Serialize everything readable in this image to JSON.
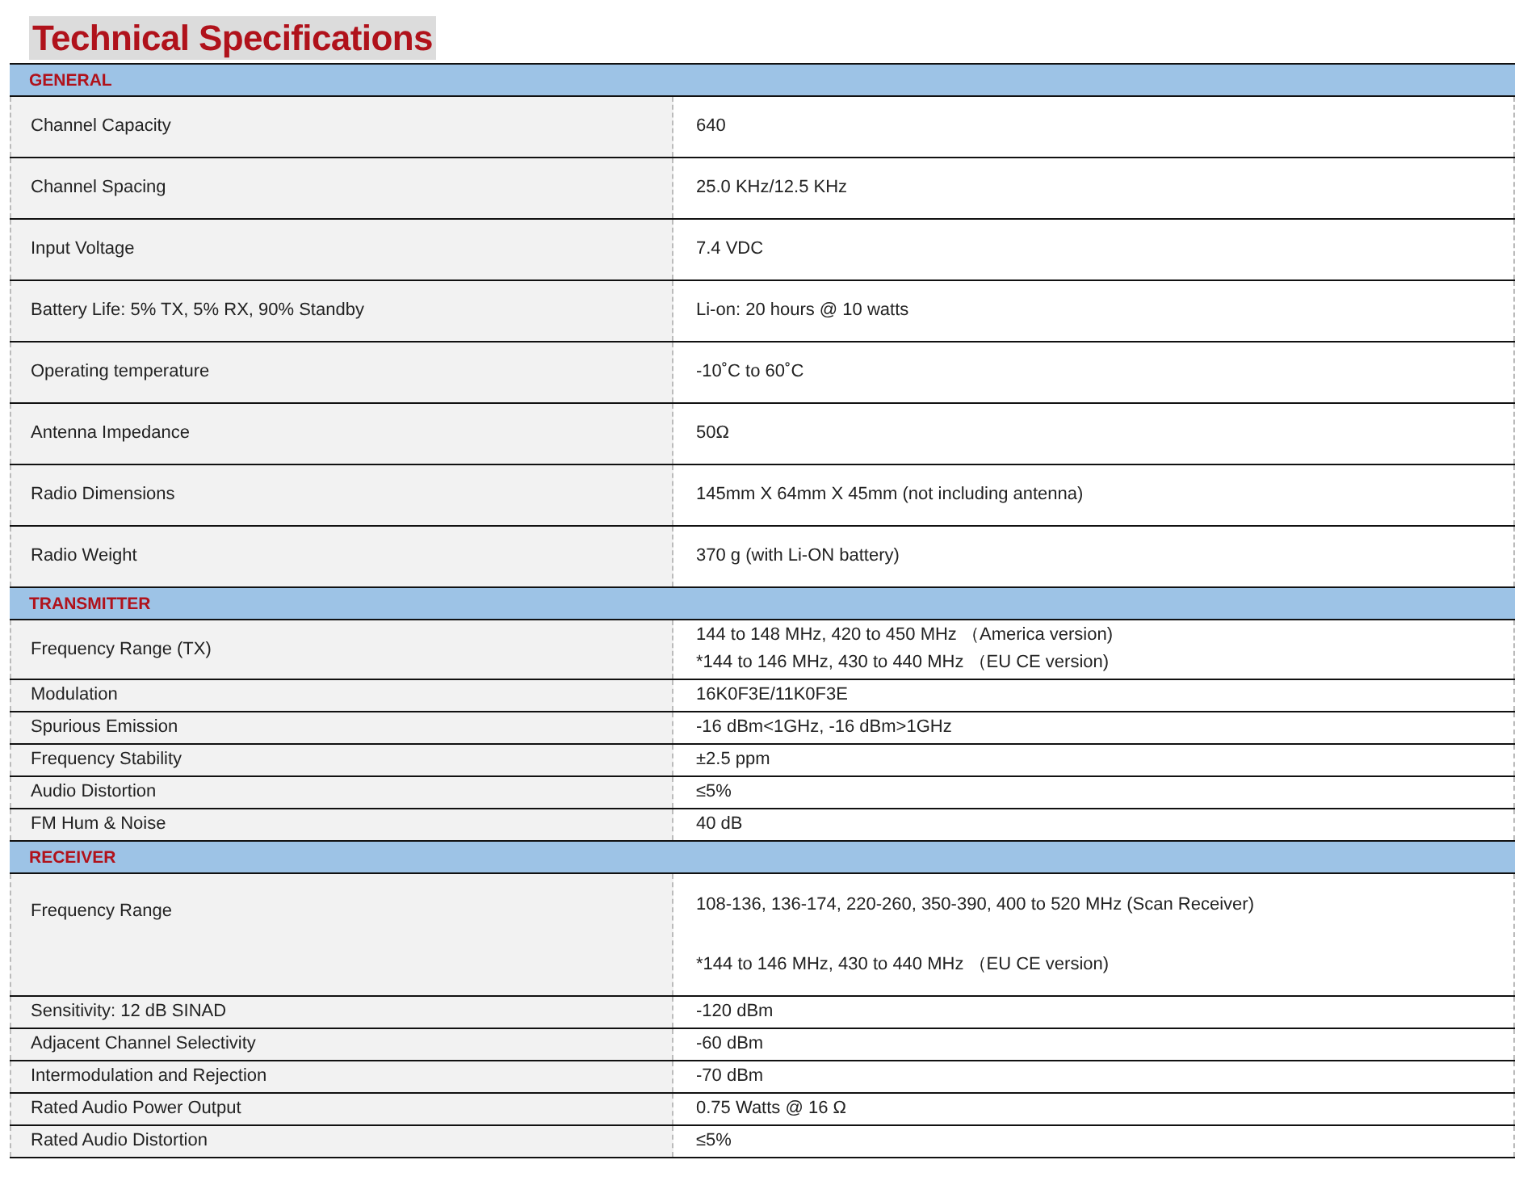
{
  "title": "Technical Specifications",
  "sections": [
    {
      "heading": "GENERAL",
      "kind": "spacious",
      "rows": [
        {
          "label": "Channel Capacity",
          "lines": [
            "640"
          ]
        },
        {
          "label": "Channel Spacing",
          "lines": [
            "25.0 KHz/12.5 KHz"
          ]
        },
        {
          "label": "Input Voltage",
          "lines": [
            "7.4 VDC"
          ]
        },
        {
          "label": "Battery Life: 5% TX, 5% RX, 90% Standby",
          "lines": [
            "Li-on: 20 hours @ 10 watts"
          ]
        },
        {
          "label": "Operating temperature",
          "lines": [
            "-10˚C to 60˚C"
          ]
        },
        {
          "label": "Antenna Impedance",
          "lines": [
            "50Ω"
          ]
        },
        {
          "label": "Radio Dimensions",
          "lines": [
            "145mm X 64mm X 45mm (not including antenna)"
          ]
        },
        {
          "label": "Radio Weight",
          "lines": [
            "370 g (with Li-ON battery)"
          ]
        }
      ]
    },
    {
      "heading": "TRANSMITTER",
      "kind": "compact",
      "rows": [
        {
          "label": "Frequency Range (TX)",
          "kind": "normal",
          "lines": [
            "144 to 148 MHz, 420 to 450 MHz （America version)",
            "*144 to 146 MHz, 430 to 440 MHz （EU CE version)"
          ]
        },
        {
          "label": "Modulation",
          "kind": "normal",
          "lines": [
            "16K0F3E/11K0F3E"
          ]
        },
        {
          "label": "Spurious Emission",
          "kind": "normal",
          "lines": [
            "-16 dBm<1GHz, -16 dBm>1GHz"
          ]
        },
        {
          "label": "Frequency Stability",
          "kind": "normal",
          "lines": [
            "±2.5 ppm"
          ]
        },
        {
          "label": "Audio Distortion",
          "kind": "normal",
          "lines": [
            "≤5%"
          ]
        },
        {
          "label": "FM Hum & Noise",
          "kind": "normal",
          "lines": [
            "40 dB"
          ]
        }
      ]
    },
    {
      "heading": "RECEIVER",
      "kind": "compact",
      "rows": [
        {
          "label": "Frequency Range",
          "kind": "tall",
          "lines": [
            "108-136, 136-174, 220-260, 350-390, 400 to 520 MHz (Scan Receiver)",
            "*144 to 146 MHz, 430 to 440 MHz （EU CE version)"
          ]
        },
        {
          "label": "Sensitivity: 12 dB SINAD",
          "kind": "normal",
          "lines": [
            "-120 dBm"
          ]
        },
        {
          "label": "Adjacent Channel Selectivity",
          "kind": "normal",
          "lines": [
            "-60 dBm"
          ]
        },
        {
          "label": "Intermodulation and Rejection",
          "kind": "normal",
          "lines": [
            "-70 dBm"
          ]
        },
        {
          "label": "Rated Audio Power Output",
          "kind": "normal",
          "lines": [
            "0.75 Watts @ 16 Ω"
          ]
        },
        {
          "label": "Rated Audio Distortion",
          "kind": "normal",
          "lines": [
            "≤5%"
          ]
        }
      ]
    }
  ]
}
